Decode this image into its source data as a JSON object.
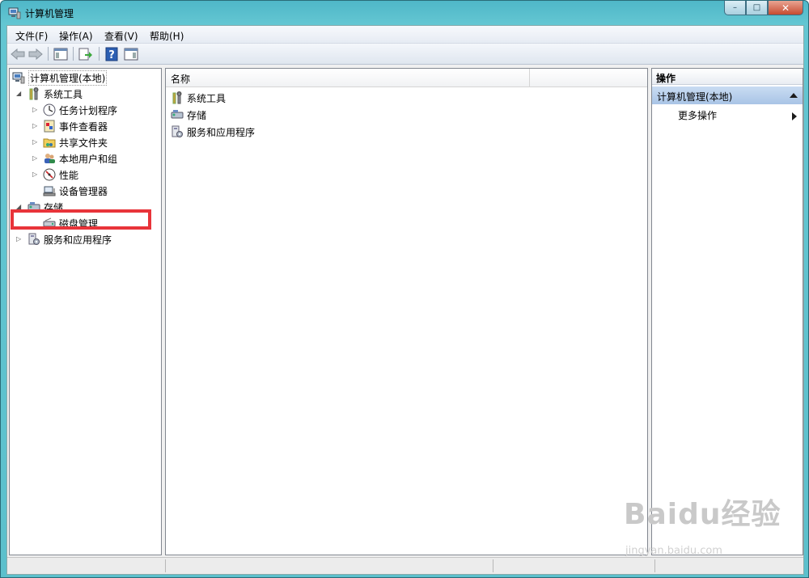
{
  "window": {
    "title": "计算机管理",
    "minimize": "–",
    "maximize": "□",
    "close": "✕"
  },
  "menubar": {
    "items": [
      "文件(F)",
      "操作(A)",
      "查看(V)",
      "帮助(H)"
    ]
  },
  "toolbar": {
    "icons": [
      "back-arrow-icon",
      "forward-arrow-icon",
      "show-tree-icon",
      "export-list-icon",
      "help-icon",
      "show-action-pane-icon"
    ]
  },
  "tree": {
    "root": "计算机管理(本地)",
    "system_tools": "系统工具",
    "task_scheduler": "任务计划程序",
    "event_viewer": "事件查看器",
    "shared_folders": "共享文件夹",
    "local_users": "本地用户和组",
    "performance": "性能",
    "device_manager": "设备管理器",
    "storage": "存储",
    "disk_management": "磁盘管理",
    "services_apps": "服务和应用程序"
  },
  "list": {
    "column_name": "名称",
    "rows": [
      "系统工具",
      "存储",
      "服务和应用程序"
    ]
  },
  "actions": {
    "title": "操作",
    "section": "计算机管理(本地)",
    "more": "更多操作"
  },
  "watermark": {
    "logo": "Baidu经验",
    "url": "jingyan.baidu.com"
  },
  "colors": {
    "highlight": "#e8343a",
    "titlebar": "#5cc0cc",
    "action_section": "#a9c4e6"
  }
}
